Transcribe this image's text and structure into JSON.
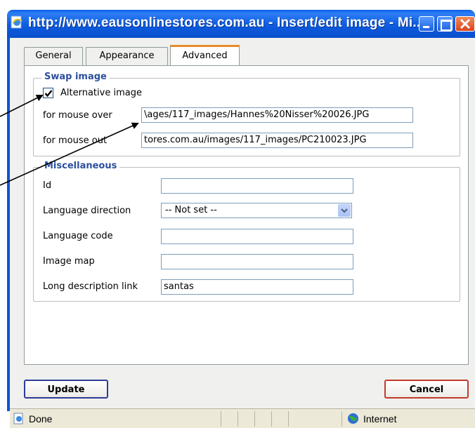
{
  "window": {
    "title": "http://www.eausonlinestores.com.au - Insert/edit image - Mi...",
    "minimize_icon": "minimize-icon",
    "maximize_icon": "maximize-icon",
    "close_icon": "close-icon"
  },
  "tabs": [
    {
      "label": "General",
      "active": false
    },
    {
      "label": "Appearance",
      "active": false
    },
    {
      "label": "Advanced",
      "active": true
    }
  ],
  "swap_image": {
    "legend": "Swap image",
    "alternative_image_label": "Alternative image",
    "alternative_image_checked": true,
    "mouse_over_label": "for mouse over",
    "mouse_over_value": "\\ages/117_images/Hannes%20Nisser%20026.JPG",
    "mouse_out_label": "for mouse out",
    "mouse_out_value": "tores.com.au/images/117_images/PC210023.JPG"
  },
  "misc": {
    "legend": "Miscellaneous",
    "id_label": "Id",
    "id_value": "",
    "lang_dir_label": "Language direction",
    "lang_dir_value": "-- Not set --",
    "lang_code_label": "Language code",
    "lang_code_value": "",
    "image_map_label": "Image map",
    "image_map_value": "",
    "long_desc_label": "Long description link",
    "long_desc_value": "santas"
  },
  "buttons": {
    "update": "Update",
    "cancel": "Cancel"
  },
  "statusbar": {
    "status": "Done",
    "zone": "Internet"
  },
  "colors": {
    "titlebar": "#0a5ee6",
    "legend": "#2c4f9e",
    "active_tab_accent": "#e68b2c"
  }
}
